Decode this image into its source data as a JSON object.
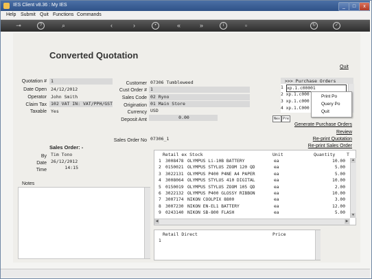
{
  "window": {
    "title": "IES Client v8.36 : My IES",
    "minimize": "_",
    "maximize": "□",
    "close": "x"
  },
  "menu": [
    "Help",
    "Submit",
    "Quit",
    "Functions",
    "Commands"
  ],
  "toolbar": {
    "icons": [
      "key-icon",
      "help-icon",
      "search-icon",
      "prev-icon",
      "next-icon",
      "skip-icon",
      "back-icon",
      "forward-icon",
      "info-icon",
      "page-icon",
      "refresh-icon",
      "submit-icon"
    ]
  },
  "page": {
    "title": "Converted Quotation",
    "quit_link": "Quit"
  },
  "left_form": {
    "quotation_label": "Quotation #",
    "quotation_value": "1",
    "date_open_label": "Date Open",
    "date_open_value": "24/12/2012",
    "operator_label": "Operator",
    "operator_value": "John Smith",
    "claim_tax_label": "Claim Tax",
    "claim_tax_value": "102 VAT IN: VAT/PPH/GST/C",
    "taxable_label": "Taxable",
    "taxable_value": "Yes"
  },
  "center_form": {
    "customer_label": "Customer",
    "customer_value": "07306 Tumbleweed",
    "cust_order_label": "Cust Order #",
    "cust_order_value": "1",
    "sales_code_label": "Sales Code",
    "sales_code_value": "02 Ryno",
    "origination_label": "Origination",
    "origination_value": "01 Main Store",
    "currency_label": "Currency",
    "currency_value": "USD",
    "deposit_label": "Deposit Amt",
    "deposit_value": "0.00",
    "sales_order_no_label": "Sales Order No",
    "sales_order_no_value": "07306_1"
  },
  "sales_order": {
    "heading": "Sales Order: -",
    "by_label": "By",
    "by_value": "Tim Tono",
    "date_label": "Date",
    "date_value": "26/12/2012",
    "time_label": "Time",
    "time_value": "14:15"
  },
  "notes_label": "Notes",
  "purchase_orders": {
    "title": ">>> Purchase Orders",
    "rows": [
      {
        "num": "1",
        "value": "xp.1.c00001"
      },
      {
        "num": "2",
        "value": "xp.1.c000"
      },
      {
        "num": "3",
        "value": "xp.1.c000"
      },
      {
        "num": "4",
        "value": "xp.1.C000"
      }
    ],
    "nav_prev": "Nex",
    "nav_next": "Pre"
  },
  "context_menu": [
    "Print Po",
    "Query Po",
    "Quit"
  ],
  "actions": [
    "Generate Purchase Orders",
    "Review",
    "Re-print Quotation",
    "Re-print Sales Order"
  ],
  "stock_table": {
    "columns": [
      "Retail ex Stock",
      "Unit",
      "Quantity",
      "T"
    ],
    "rows": [
      {
        "n": "1",
        "code": "3008478",
        "desc": "OLYMPUS Li-10B BATTERY",
        "unit": "ea",
        "qty": "10.00"
      },
      {
        "n": "2",
        "code": "0150021",
        "desc": "OLYMPUS STYLUS ZOOM 120 QD",
        "unit": "ea",
        "qty": "5.00"
      },
      {
        "n": "3",
        "code": "3022131",
        "desc": "OLYMPUS P400 P4NE A4 PAPER",
        "unit": "ea",
        "qty": "5.00"
      },
      {
        "n": "4",
        "code": "3008064",
        "desc": "OLYMPUS STYLUS 410 DIGITAL",
        "unit": "ea",
        "qty": "10.00"
      },
      {
        "n": "5",
        "code": "0150019",
        "desc": "OLYMPUS STYLUS ZOOM 105 QD",
        "unit": "ea",
        "qty": "2.00"
      },
      {
        "n": "6",
        "code": "3022132",
        "desc": "OLYMPUS P400 GLOSSY RIBBON",
        "unit": "ea",
        "qty": "10.00"
      },
      {
        "n": "7",
        "code": "3007174",
        "desc": "NIKON COOLPIX 8800",
        "unit": "ea",
        "qty": "3.00"
      },
      {
        "n": "8",
        "code": "3007230",
        "desc": "NIKON EN-EL1 BATTERY",
        "unit": "ea",
        "qty": "12.00"
      },
      {
        "n": "9",
        "code": "0243140",
        "desc": "NIKON SB-800 FLASH",
        "unit": "ea",
        "qty": "5.00"
      }
    ]
  },
  "direct_table": {
    "columns": [
      "Retail Direct",
      "Price"
    ],
    "rows": [
      {
        "n": "1"
      }
    ]
  }
}
